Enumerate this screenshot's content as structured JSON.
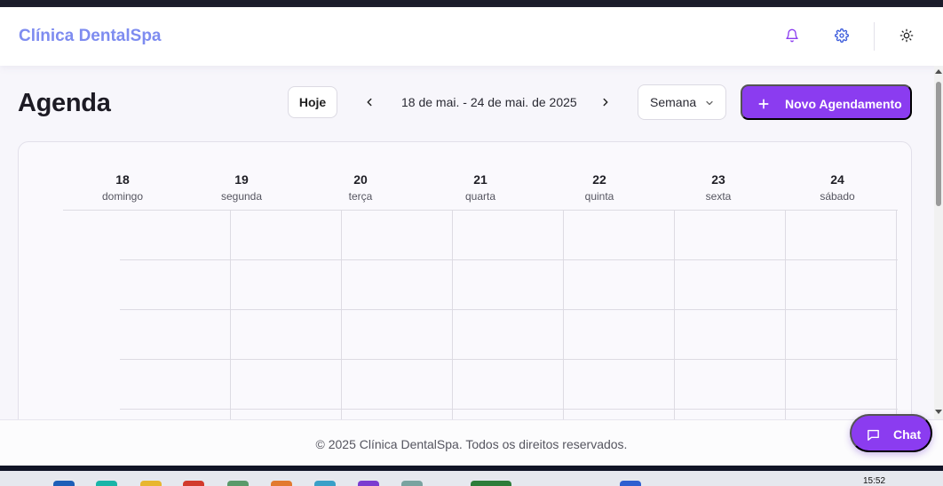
{
  "header": {
    "brand": "Clínica DentalSpa",
    "icons": [
      "bell-icon",
      "gear-icon",
      "sun-icon"
    ],
    "accent": "#8b3cf0",
    "brand_color": "#7e8cf0"
  },
  "toolbar": {
    "title": "Agenda",
    "today_label": "Hoje",
    "date_range": "18 de mai. - 24 de mai. de 2025",
    "view_value": "Semana",
    "new_label": "Novo Agendamento"
  },
  "calendar": {
    "days": [
      {
        "num": "18",
        "name": "domingo"
      },
      {
        "num": "19",
        "name": "segunda"
      },
      {
        "num": "20",
        "name": "terça"
      },
      {
        "num": "21",
        "name": "quarta"
      },
      {
        "num": "22",
        "name": "quinta"
      },
      {
        "num": "23",
        "name": "sexta"
      },
      {
        "num": "24",
        "name": "sábado"
      }
    ]
  },
  "footer": {
    "text": "© 2025 Clínica DentalSpa. Todos os direitos reservados."
  },
  "chat": {
    "label": "Chat"
  },
  "taskbar": {
    "clock": "15:52"
  }
}
